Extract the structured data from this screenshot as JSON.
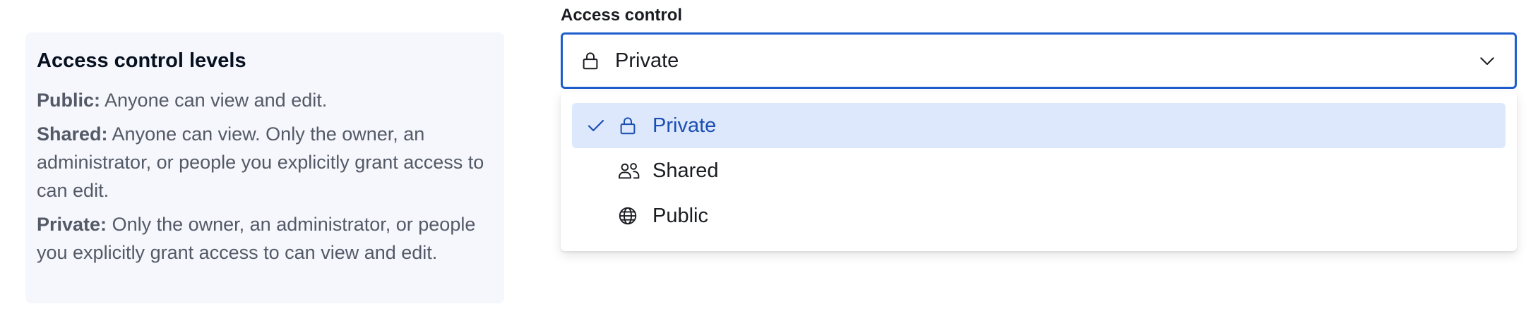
{
  "info": {
    "title": "Access control levels",
    "items": [
      {
        "term": "Public:",
        "desc": " Anyone can view and edit."
      },
      {
        "term": "Shared:",
        "desc": " Anyone can view. Only the owner, an administrator, or people you explicitly grant access to can edit."
      },
      {
        "term": "Private:",
        "desc": " Only the owner, an administrator, or people you explicitly grant access to can view and edit."
      }
    ]
  },
  "field": {
    "label": "Access control",
    "selected_value": "Private",
    "selected_icon": "lock-icon"
  },
  "dropdown": {
    "options": [
      {
        "label": "Private",
        "icon": "lock-icon",
        "selected": true
      },
      {
        "label": "Shared",
        "icon": "users-icon",
        "selected": false
      },
      {
        "label": "Public",
        "icon": "globe-icon",
        "selected": false
      }
    ]
  },
  "colors": {
    "accent": "#1e5dcc",
    "selected_bg": "#dde8fc",
    "selected_text": "#1b4fb3",
    "panel_bg": "#f5f7fc",
    "muted_text": "#535966"
  }
}
